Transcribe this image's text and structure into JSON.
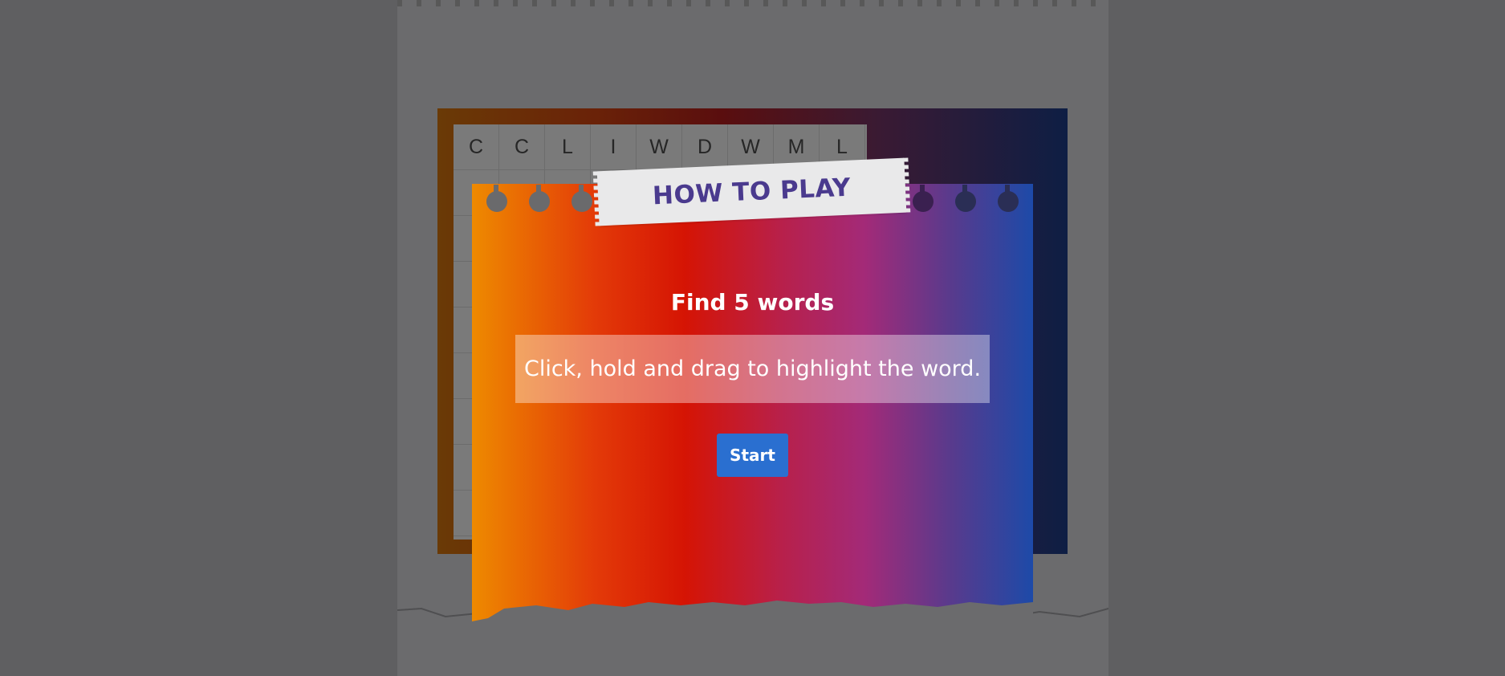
{
  "modal": {
    "title": "HOW TO PLAY",
    "headline": "Find 5 words",
    "instruction": "Click, hold and drag to highlight the word.",
    "start_label": "Start"
  },
  "board": {
    "first_row": [
      "C",
      "C",
      "L",
      "I",
      "W",
      "D",
      "W",
      "M",
      "L"
    ]
  },
  "colors": {
    "overlay": "#5f5f61",
    "title_text": "#4a3a8e",
    "start_button": "#2a6fd0",
    "modal_gradient": [
      "#ee8a00",
      "#d51404",
      "#a32a78",
      "#1d4aa8"
    ]
  }
}
